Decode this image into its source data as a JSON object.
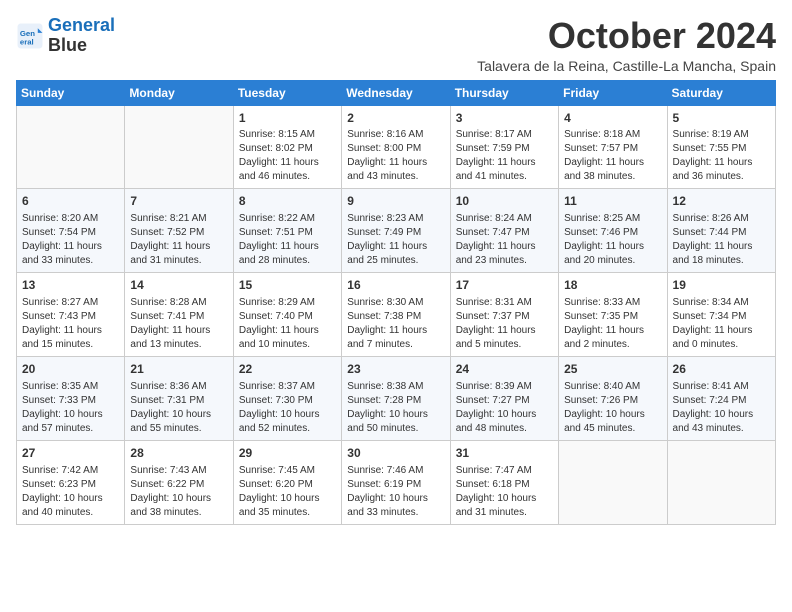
{
  "header": {
    "logo_line1": "General",
    "logo_line2": "Blue",
    "month_title": "October 2024",
    "subtitle": "Talavera de la Reina, Castille-La Mancha, Spain"
  },
  "weekdays": [
    "Sunday",
    "Monday",
    "Tuesday",
    "Wednesday",
    "Thursday",
    "Friday",
    "Saturday"
  ],
  "weeks": [
    [
      {
        "day": "",
        "info": ""
      },
      {
        "day": "",
        "info": ""
      },
      {
        "day": "1",
        "info": "Sunrise: 8:15 AM\nSunset: 8:02 PM\nDaylight: 11 hours and 46 minutes."
      },
      {
        "day": "2",
        "info": "Sunrise: 8:16 AM\nSunset: 8:00 PM\nDaylight: 11 hours and 43 minutes."
      },
      {
        "day": "3",
        "info": "Sunrise: 8:17 AM\nSunset: 7:59 PM\nDaylight: 11 hours and 41 minutes."
      },
      {
        "day": "4",
        "info": "Sunrise: 8:18 AM\nSunset: 7:57 PM\nDaylight: 11 hours and 38 minutes."
      },
      {
        "day": "5",
        "info": "Sunrise: 8:19 AM\nSunset: 7:55 PM\nDaylight: 11 hours and 36 minutes."
      }
    ],
    [
      {
        "day": "6",
        "info": "Sunrise: 8:20 AM\nSunset: 7:54 PM\nDaylight: 11 hours and 33 minutes."
      },
      {
        "day": "7",
        "info": "Sunrise: 8:21 AM\nSunset: 7:52 PM\nDaylight: 11 hours and 31 minutes."
      },
      {
        "day": "8",
        "info": "Sunrise: 8:22 AM\nSunset: 7:51 PM\nDaylight: 11 hours and 28 minutes."
      },
      {
        "day": "9",
        "info": "Sunrise: 8:23 AM\nSunset: 7:49 PM\nDaylight: 11 hours and 25 minutes."
      },
      {
        "day": "10",
        "info": "Sunrise: 8:24 AM\nSunset: 7:47 PM\nDaylight: 11 hours and 23 minutes."
      },
      {
        "day": "11",
        "info": "Sunrise: 8:25 AM\nSunset: 7:46 PM\nDaylight: 11 hours and 20 minutes."
      },
      {
        "day": "12",
        "info": "Sunrise: 8:26 AM\nSunset: 7:44 PM\nDaylight: 11 hours and 18 minutes."
      }
    ],
    [
      {
        "day": "13",
        "info": "Sunrise: 8:27 AM\nSunset: 7:43 PM\nDaylight: 11 hours and 15 minutes."
      },
      {
        "day": "14",
        "info": "Sunrise: 8:28 AM\nSunset: 7:41 PM\nDaylight: 11 hours and 13 minutes."
      },
      {
        "day": "15",
        "info": "Sunrise: 8:29 AM\nSunset: 7:40 PM\nDaylight: 11 hours and 10 minutes."
      },
      {
        "day": "16",
        "info": "Sunrise: 8:30 AM\nSunset: 7:38 PM\nDaylight: 11 hours and 7 minutes."
      },
      {
        "day": "17",
        "info": "Sunrise: 8:31 AM\nSunset: 7:37 PM\nDaylight: 11 hours and 5 minutes."
      },
      {
        "day": "18",
        "info": "Sunrise: 8:33 AM\nSunset: 7:35 PM\nDaylight: 11 hours and 2 minutes."
      },
      {
        "day": "19",
        "info": "Sunrise: 8:34 AM\nSunset: 7:34 PM\nDaylight: 11 hours and 0 minutes."
      }
    ],
    [
      {
        "day": "20",
        "info": "Sunrise: 8:35 AM\nSunset: 7:33 PM\nDaylight: 10 hours and 57 minutes."
      },
      {
        "day": "21",
        "info": "Sunrise: 8:36 AM\nSunset: 7:31 PM\nDaylight: 10 hours and 55 minutes."
      },
      {
        "day": "22",
        "info": "Sunrise: 8:37 AM\nSunset: 7:30 PM\nDaylight: 10 hours and 52 minutes."
      },
      {
        "day": "23",
        "info": "Sunrise: 8:38 AM\nSunset: 7:28 PM\nDaylight: 10 hours and 50 minutes."
      },
      {
        "day": "24",
        "info": "Sunrise: 8:39 AM\nSunset: 7:27 PM\nDaylight: 10 hours and 48 minutes."
      },
      {
        "day": "25",
        "info": "Sunrise: 8:40 AM\nSunset: 7:26 PM\nDaylight: 10 hours and 45 minutes."
      },
      {
        "day": "26",
        "info": "Sunrise: 8:41 AM\nSunset: 7:24 PM\nDaylight: 10 hours and 43 minutes."
      }
    ],
    [
      {
        "day": "27",
        "info": "Sunrise: 7:42 AM\nSunset: 6:23 PM\nDaylight: 10 hours and 40 minutes."
      },
      {
        "day": "28",
        "info": "Sunrise: 7:43 AM\nSunset: 6:22 PM\nDaylight: 10 hours and 38 minutes."
      },
      {
        "day": "29",
        "info": "Sunrise: 7:45 AM\nSunset: 6:20 PM\nDaylight: 10 hours and 35 minutes."
      },
      {
        "day": "30",
        "info": "Sunrise: 7:46 AM\nSunset: 6:19 PM\nDaylight: 10 hours and 33 minutes."
      },
      {
        "day": "31",
        "info": "Sunrise: 7:47 AM\nSunset: 6:18 PM\nDaylight: 10 hours and 31 minutes."
      },
      {
        "day": "",
        "info": ""
      },
      {
        "day": "",
        "info": ""
      }
    ]
  ]
}
